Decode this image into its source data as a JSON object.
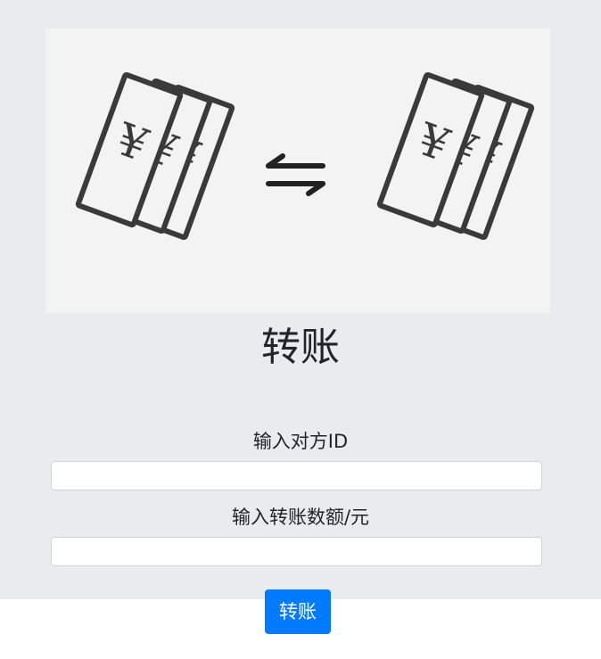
{
  "banner": {
    "left_symbol": "¥",
    "exchange_icon": "exchange-arrows-icon",
    "right_symbol": "¥"
  },
  "page": {
    "title": "转账"
  },
  "form": {
    "id_label": "输入对方ID",
    "id_value": "",
    "id_placeholder": "",
    "amount_label": "输入转账数额/元",
    "amount_value": "",
    "amount_placeholder": "",
    "submit_label": "转账"
  },
  "colors": {
    "panel_bg": "#e9ecef",
    "banner_bg": "#f3f3f3",
    "icon_stroke": "#3a3a3a",
    "button_bg": "#007bff",
    "button_text": "#ffffff"
  }
}
